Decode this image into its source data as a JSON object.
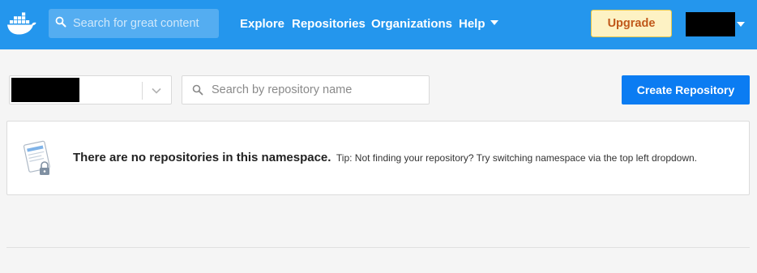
{
  "header": {
    "logo": "docker-whale-icon",
    "search_placeholder": "Search for great content",
    "nav": {
      "explore": "Explore",
      "repositories": "Repositories",
      "organizations": "Organizations",
      "help": "Help"
    },
    "upgrade_label": "Upgrade",
    "user_caret": "chevron-down-icon"
  },
  "toolbar": {
    "namespace_chevron": "chevron-down-icon",
    "repo_search_placeholder": "Search by repository name",
    "create_label": "Create Repository"
  },
  "empty_state": {
    "icon": "locked-repository-icon",
    "title": "There are no repositories in this namespace.",
    "tip": "Tip: Not finding your repository? Try switching namespace via the top left dropdown."
  },
  "colors": {
    "nav_bg": "#2496ed",
    "primary_button": "#0b7cf2",
    "upgrade_bg": "#fdf2c4",
    "upgrade_text": "#c0581a",
    "page_bg": "#f5f5f5"
  }
}
